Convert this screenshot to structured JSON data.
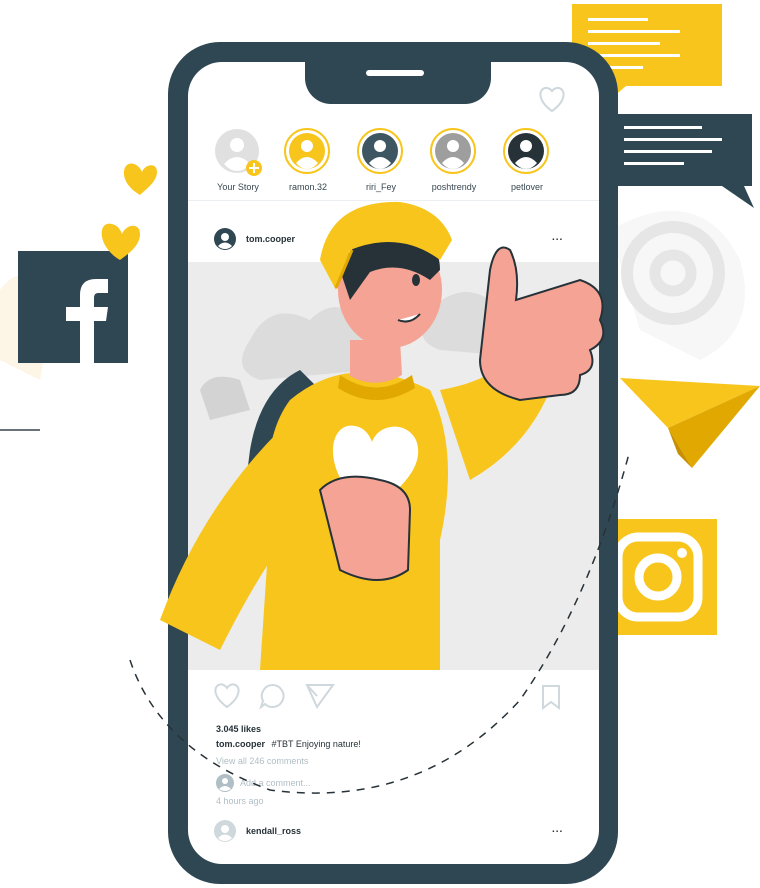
{
  "stories": [
    {
      "name": "Your Story",
      "variant": "own"
    },
    {
      "name": "ramon.32",
      "variant": "yellow"
    },
    {
      "name": "riri_Fey",
      "variant": "dark"
    },
    {
      "name": "poshtrendy",
      "variant": "gray"
    },
    {
      "name": "petlover",
      "variant": "dark"
    }
  ],
  "post": {
    "username": "tom.cooper",
    "more_icon": "...",
    "likes": "3.045 likes",
    "caption_user": "tom.cooper",
    "caption_text": "#TBT  Enjoying nature!",
    "view_comments": "View all 246 comments",
    "add_comment": "Add a comment...",
    "time": "4 hours ago"
  },
  "next_post": {
    "username": "kendall_ross",
    "more_icon": "..."
  },
  "icons": [
    "facebook-icon",
    "instagram-icon",
    "at-sign-icon",
    "paper-plane-icon",
    "heart-icon",
    "comment-icon",
    "send-icon",
    "bookmark-icon",
    "chat-bubble-icon"
  ],
  "colors": {
    "accent": "#f8c51c",
    "dark": "#2f4752",
    "skin": "#f4a394",
    "light_gray": "#e0e0e0"
  }
}
